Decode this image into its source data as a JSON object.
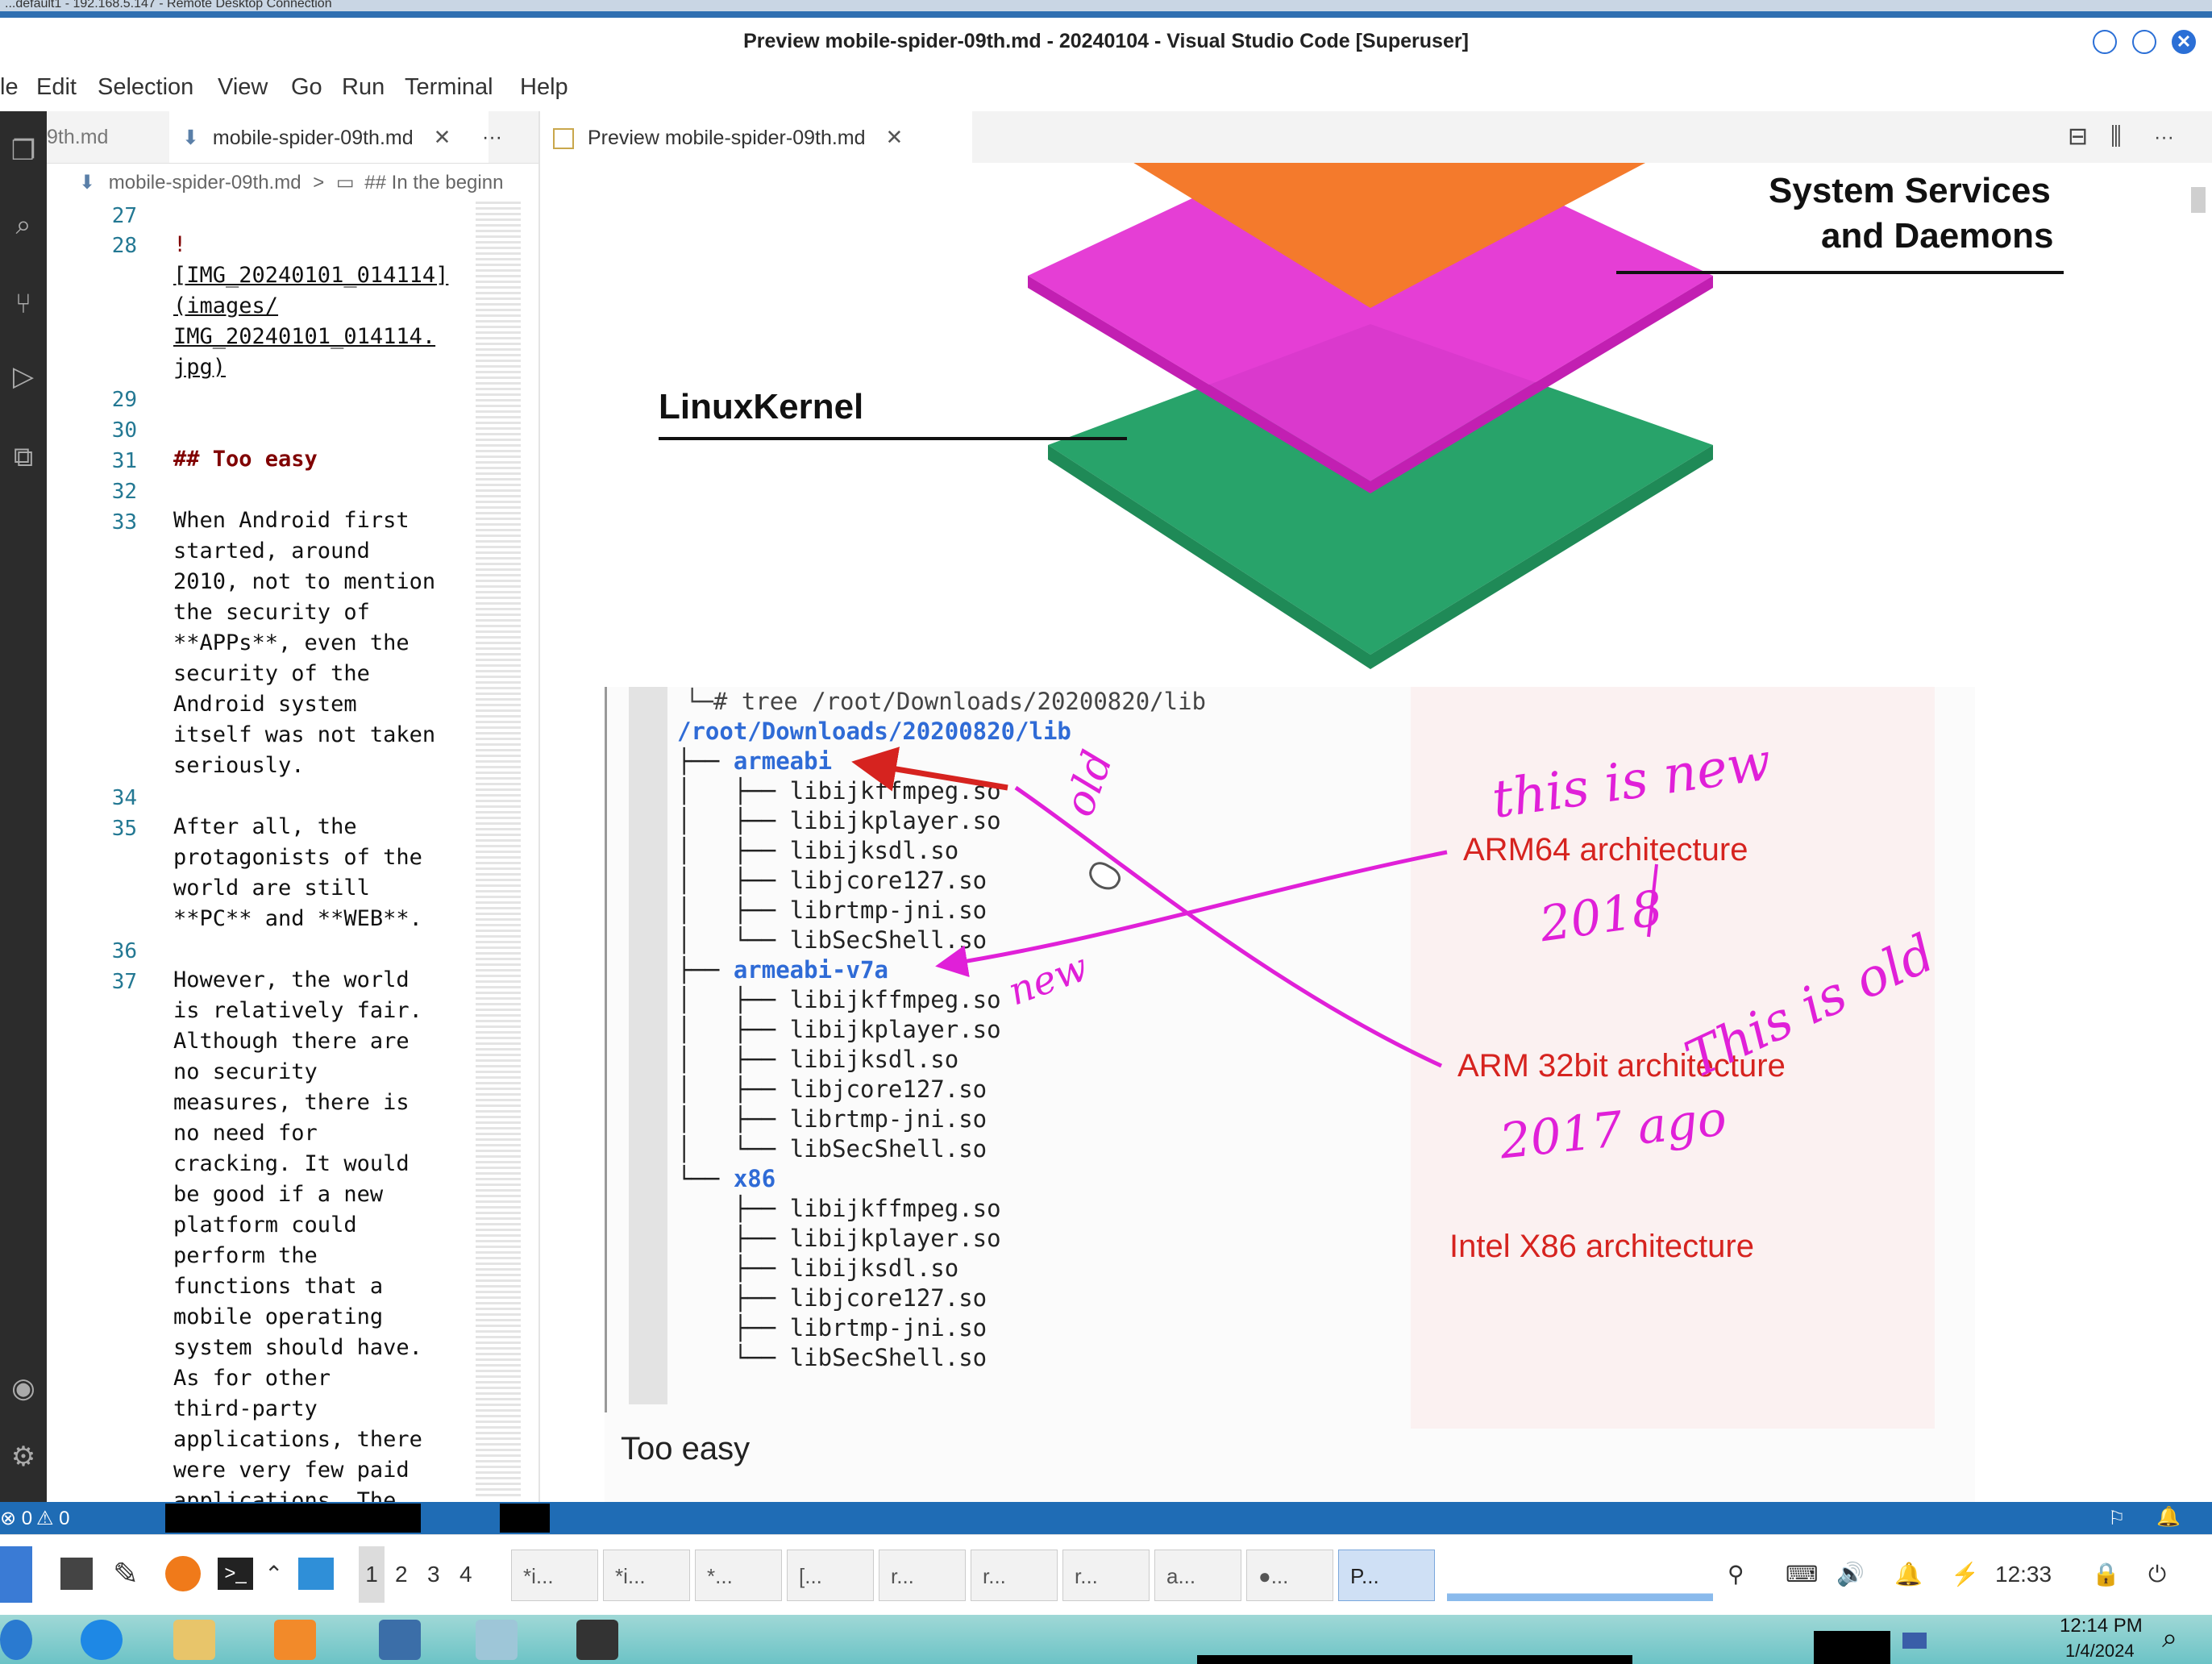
{
  "remote": {
    "title": "...default1 - 192.168.5.147 - Remote Desktop Connection"
  },
  "window": {
    "title": "Preview mobile-spider-09th.md - 20240104 - Visual Studio Code [Superuser]",
    "close_glyph": "✕"
  },
  "menu": {
    "items": [
      "le",
      "Edit",
      "Selection",
      "View",
      "Go",
      "Run",
      "Terminal",
      "Help"
    ]
  },
  "tabs": {
    "tab0": "9th.md",
    "tab1": "mobile-spider-09th.md",
    "tab2": "Preview mobile-spider-09th.md",
    "more": "···",
    "close_glyph": "✕"
  },
  "editor_actions": {
    "split": "⊟",
    "columns": "⫼",
    "more": "···"
  },
  "breadcrumb": {
    "file": "mobile-spider-09th.md",
    "separator": ">",
    "section": "## In the beginn"
  },
  "editor": {
    "line_numbers": [
      "27",
      "28",
      "29",
      "30",
      "31",
      "32",
      "33",
      "34",
      "35",
      "36",
      "37"
    ],
    "line28": {
      "bang": "!",
      "alt": "[IMG_20240101_014114]",
      "path1": "(images/",
      "path2": "IMG_20240101_014114.",
      "path3": "jpg)"
    },
    "heading": "## Too easy",
    "p33": [
      "When Android first",
      "started, around",
      "2010, not to mention",
      "the security of",
      "**APPs**, even the",
      "security of the",
      "Android system",
      "itself was not taken",
      "seriously."
    ],
    "p35": [
      "After all, the",
      "protagonists of the",
      "world are still",
      "**PC** and **WEB**."
    ],
    "p37": [
      "However, the world",
      "is relatively fair.",
      "Although there are",
      "no security",
      "measures, there is",
      "no need for",
      "cracking. It would",
      "be good if a new",
      "platform could",
      "perform the",
      "functions that a",
      "mobile operating",
      "system should have.",
      "As for other",
      "third-party",
      "applications, there",
      "were very few paid",
      "applications. The"
    ]
  },
  "preview": {
    "label_services": [
      "System Services",
      "and Daemons"
    ],
    "label_kernel": "LinuxKernel",
    "tree": {
      "cmd": "└─# tree /root/Downloads/20200820/lib",
      "root": "/root/Downloads/20200820/lib",
      "dirs": [
        "armeabi",
        "armeabi-v7a",
        "x86"
      ],
      "libs": [
        "libijkffmpeg.so",
        "libijkplayer.so",
        "libijksdl.so",
        "libjcore127.so",
        "librtmp-jni.so",
        "libSecShell.so"
      ]
    },
    "annotations": {
      "arm64": "ARM64 architecture",
      "arm32": "ARM 32bit architecture",
      "x86": "Intel X86 architecture"
    },
    "handwritten": {
      "old": "old",
      "new": "new",
      "this_is_new": "this is new",
      "year_2018": "2018",
      "this_is_old": "This is old",
      "year_2017": "2017 ago"
    },
    "heading": "Too easy"
  },
  "status": {
    "errors": "⊗ 0",
    "warnings": "⚠ 0",
    "broadcast": "⚐",
    "bell": "🔔"
  },
  "panel": {
    "workspaces": [
      "1",
      "2",
      "3",
      "4"
    ],
    "tasks": [
      "*i...",
      "*i...",
      "*...",
      "[...",
      "r...",
      "r...",
      "r...",
      "a...",
      "●...",
      "P..."
    ],
    "clock": "12:33",
    "tray": {
      "volume": "🔊",
      "bell": "🔔",
      "battery": "⚡",
      "lock": "🔒",
      "logout": "⏻"
    }
  },
  "windows": {
    "time": "12:14 PM",
    "date": "1/4/2024"
  },
  "colors": {
    "accent": "#1f6cb5",
    "orange_layer": "#f47a2c",
    "magenta_layer": "#e434d3",
    "green_layer": "#28a36a",
    "red_arrow": "#d6231f",
    "pen": "#e020d8"
  }
}
